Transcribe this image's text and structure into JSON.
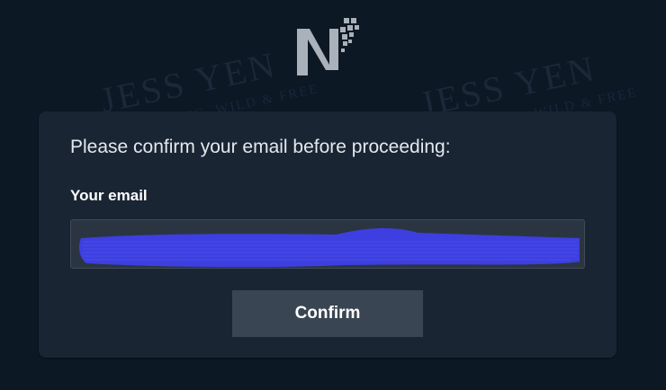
{
  "watermark": {
    "brand": "JESS YEN",
    "tagline": "LIVING YOUNG, WILD & FREE"
  },
  "logo": {
    "icon": "nf-logo-icon",
    "letter": "N",
    "color": "#a9b2bb"
  },
  "card": {
    "prompt": "Please confirm your email before proceeding:",
    "email_label": "Your email",
    "email_value": "",
    "redaction_color": "#3d3fe0",
    "confirm_label": "Confirm"
  }
}
